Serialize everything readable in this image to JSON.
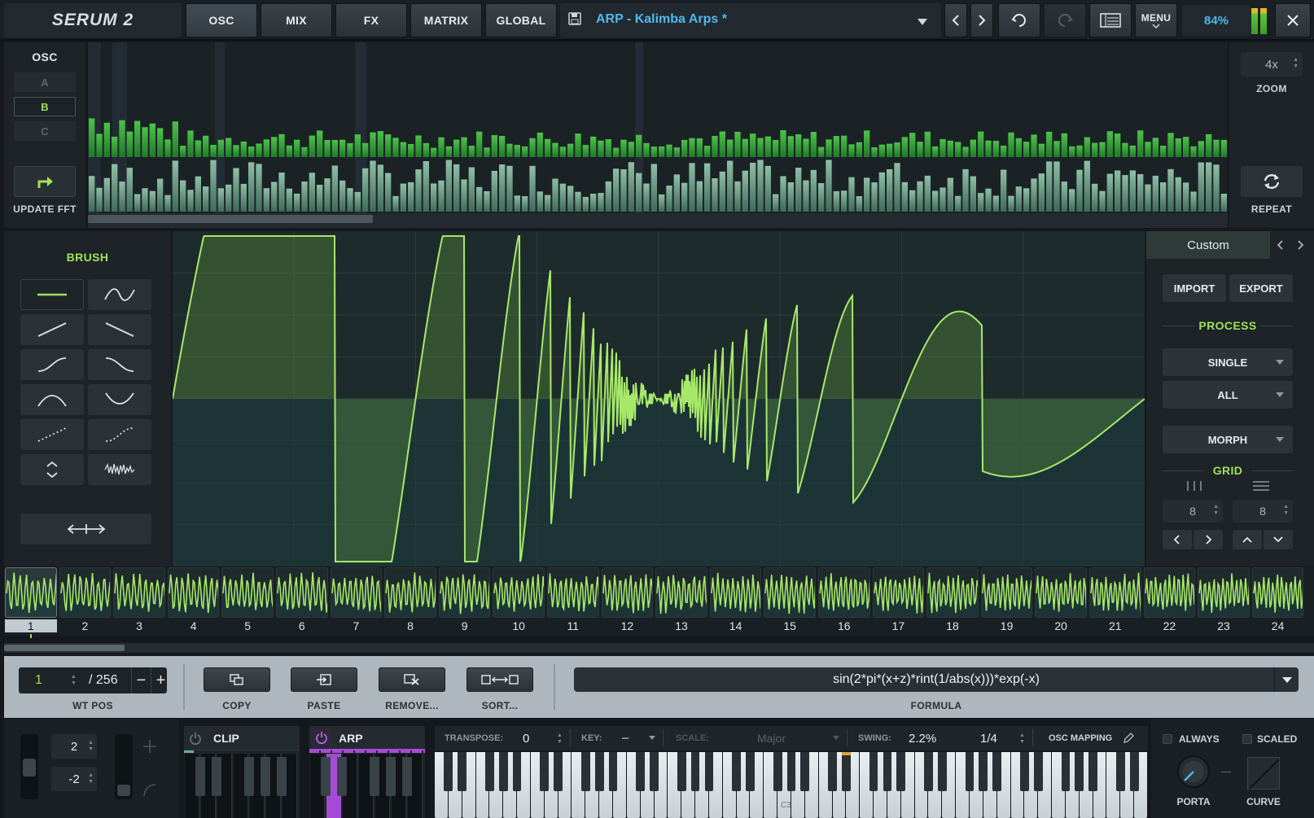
{
  "app": {
    "logo": "SERUM 2"
  },
  "nav": {
    "tabs": [
      {
        "label": "OSC"
      },
      {
        "label": "MIX"
      },
      {
        "label": "FX"
      },
      {
        "label": "MATRIX"
      },
      {
        "label": "GLOBAL"
      }
    ]
  },
  "preset": {
    "name": "ARP - Kalimba Arps *"
  },
  "toolbar": {
    "menu": "MENU",
    "cpu": "84%"
  },
  "osc_panel": {
    "title": "OSC",
    "options": [
      "A",
      "B",
      "C"
    ],
    "selected": "B",
    "update_fft": "UPDATE FFT"
  },
  "zoom_panel": {
    "zoom_value": "4x",
    "zoom_label": "ZOOM",
    "repeat_label": "REPEAT"
  },
  "brush": {
    "title": "BRUSH"
  },
  "process_panel": {
    "custom_label": "Custom",
    "import": "IMPORT",
    "export": "EXPORT",
    "process_title": "PROCESS",
    "single": "SINGLE",
    "all": "ALL",
    "morph": "MORPH",
    "grid_title": "GRID",
    "grid_x": "8",
    "grid_y": "8"
  },
  "wavetable": {
    "selected_frame": 1,
    "frames": [
      "1",
      "2",
      "3",
      "4",
      "5",
      "6",
      "7",
      "8",
      "9",
      "10",
      "11",
      "12",
      "13",
      "14",
      "15",
      "16",
      "17",
      "18",
      "19",
      "20",
      "21",
      "22",
      "23",
      "24"
    ]
  },
  "wt_row": {
    "pos_value": "1",
    "pos_total": "/ 256",
    "pos_label": "WT POS",
    "copy": "COPY",
    "paste": "PASTE",
    "remove": "REMOVE...",
    "sort": "SORT...",
    "formula": "sin(2*pi*(x+z)*rint(1/abs(x)))*exp(-x)",
    "formula_label": "FORMULA"
  },
  "bottom": {
    "pitch_up": "2",
    "pitch_down": "-2",
    "clip_label": "CLIP",
    "arp_label": "ARP",
    "transpose_label": "TRANSPOSE:",
    "transpose_value": "0",
    "key_label": "KEY:",
    "key_value": "–",
    "scale_label": "SCALE:",
    "scale_value": "Major",
    "swing_label": "SWING:",
    "swing_value": "2.2%",
    "rate_value": "1/4",
    "osc_mapping": "OSC MAPPING",
    "always_label": "ALWAYS",
    "scaled_label": "SCALED",
    "porta_label": "PORTA",
    "curve_label": "CURVE",
    "c3_label": "C3"
  },
  "colors": {
    "accent_green": "#9fe25a",
    "accent_cyan": "#4fb8ec",
    "arp_purple": "#a64bd6"
  }
}
